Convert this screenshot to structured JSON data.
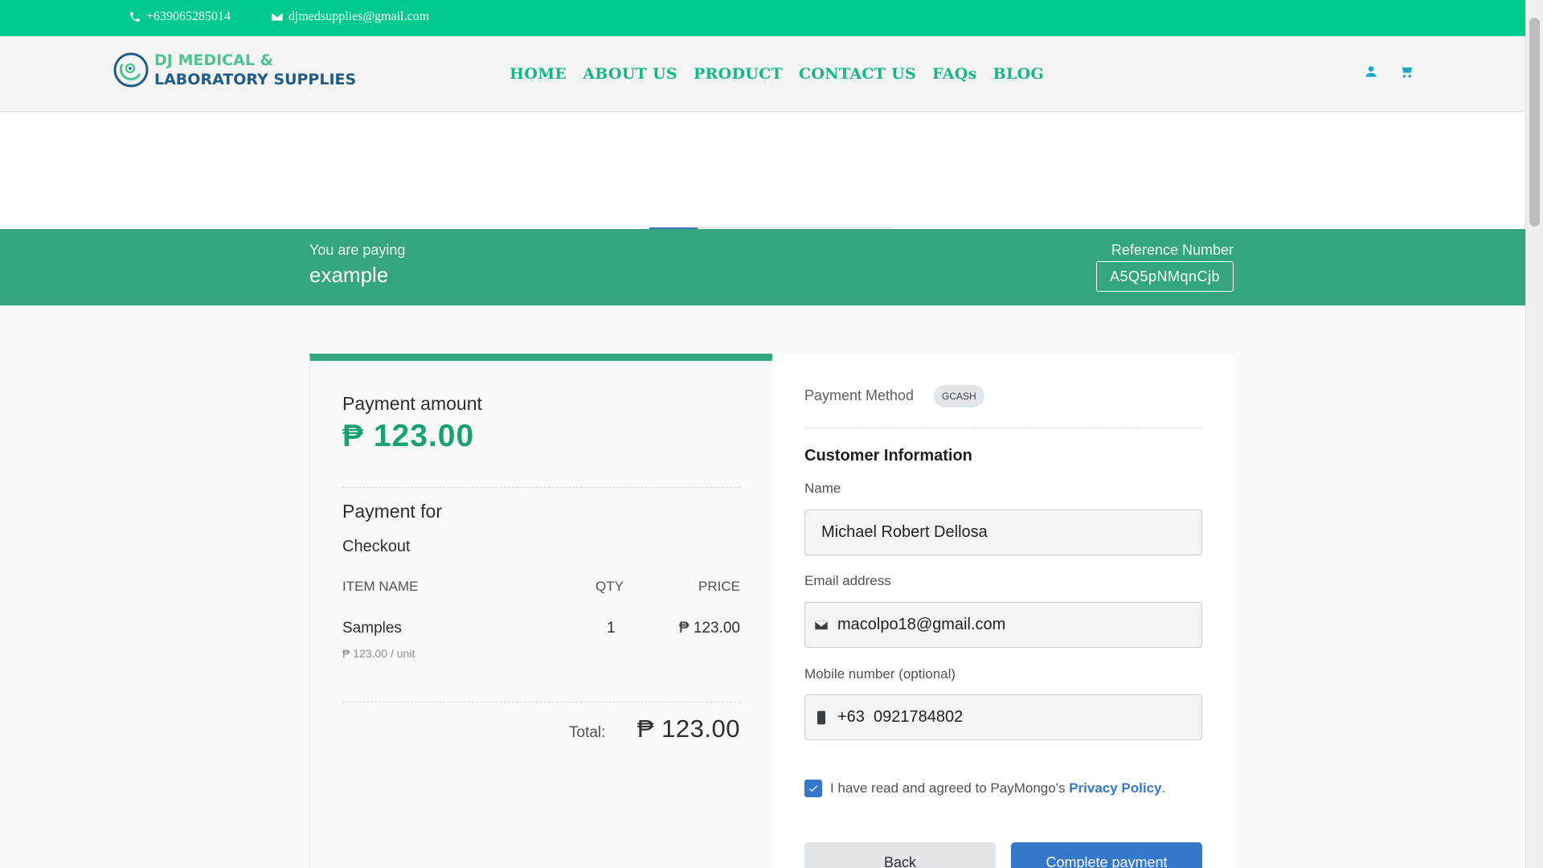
{
  "topbar": {
    "phone": "+639065285014",
    "email": "djmedsupplies@gmail.com"
  },
  "brand": {
    "line1": "DJ MEDICAL &",
    "line2": "LABORATORY SUPPLIES"
  },
  "nav": {
    "items": [
      "HOME",
      "ABOUT US",
      "PRODUCT",
      "CONTACT US",
      "FAQs",
      "BLOG"
    ]
  },
  "hero": {
    "paying_label": "You are paying",
    "paying_value": "example",
    "reference_label": "Reference Number",
    "reference_value": "A5Q5pNMqnCjb"
  },
  "summary": {
    "amount_label": "Payment amount",
    "amount_value": "₱ 123.00",
    "payment_for_label": "Payment for",
    "payment_for_value": "Checkout",
    "columns": [
      "ITEM NAME",
      "QTY",
      "PRICE"
    ],
    "items": [
      {
        "name": "Samples",
        "qty": "1",
        "price": "₱ 123.00",
        "unit": "₱ 123.00 / unit"
      }
    ],
    "total_label": "Total:",
    "total_value": "₱ 123.00"
  },
  "form": {
    "payment_method_label": "Payment Method",
    "payment_method_value": "GCASH",
    "section_title": "Customer Information",
    "name_label": "Name",
    "name_value": "Michael Robert Dellosa",
    "email_label": "Email address",
    "email_value": "macolpo18@gmail.com",
    "mobile_label": "Mobile number (optional)",
    "mobile_value": "+63  0921784802",
    "agree_text": "I have read and agreed to PayMongo's",
    "agree_link": "Privacy Policy",
    "agree_end": ".",
    "back_label": "Back",
    "complete_label": "Complete payment"
  },
  "colors": {
    "topbar": "#00c98d",
    "hero": "#34a57f",
    "amount": "#1aa172",
    "link": "#3577c9"
  }
}
